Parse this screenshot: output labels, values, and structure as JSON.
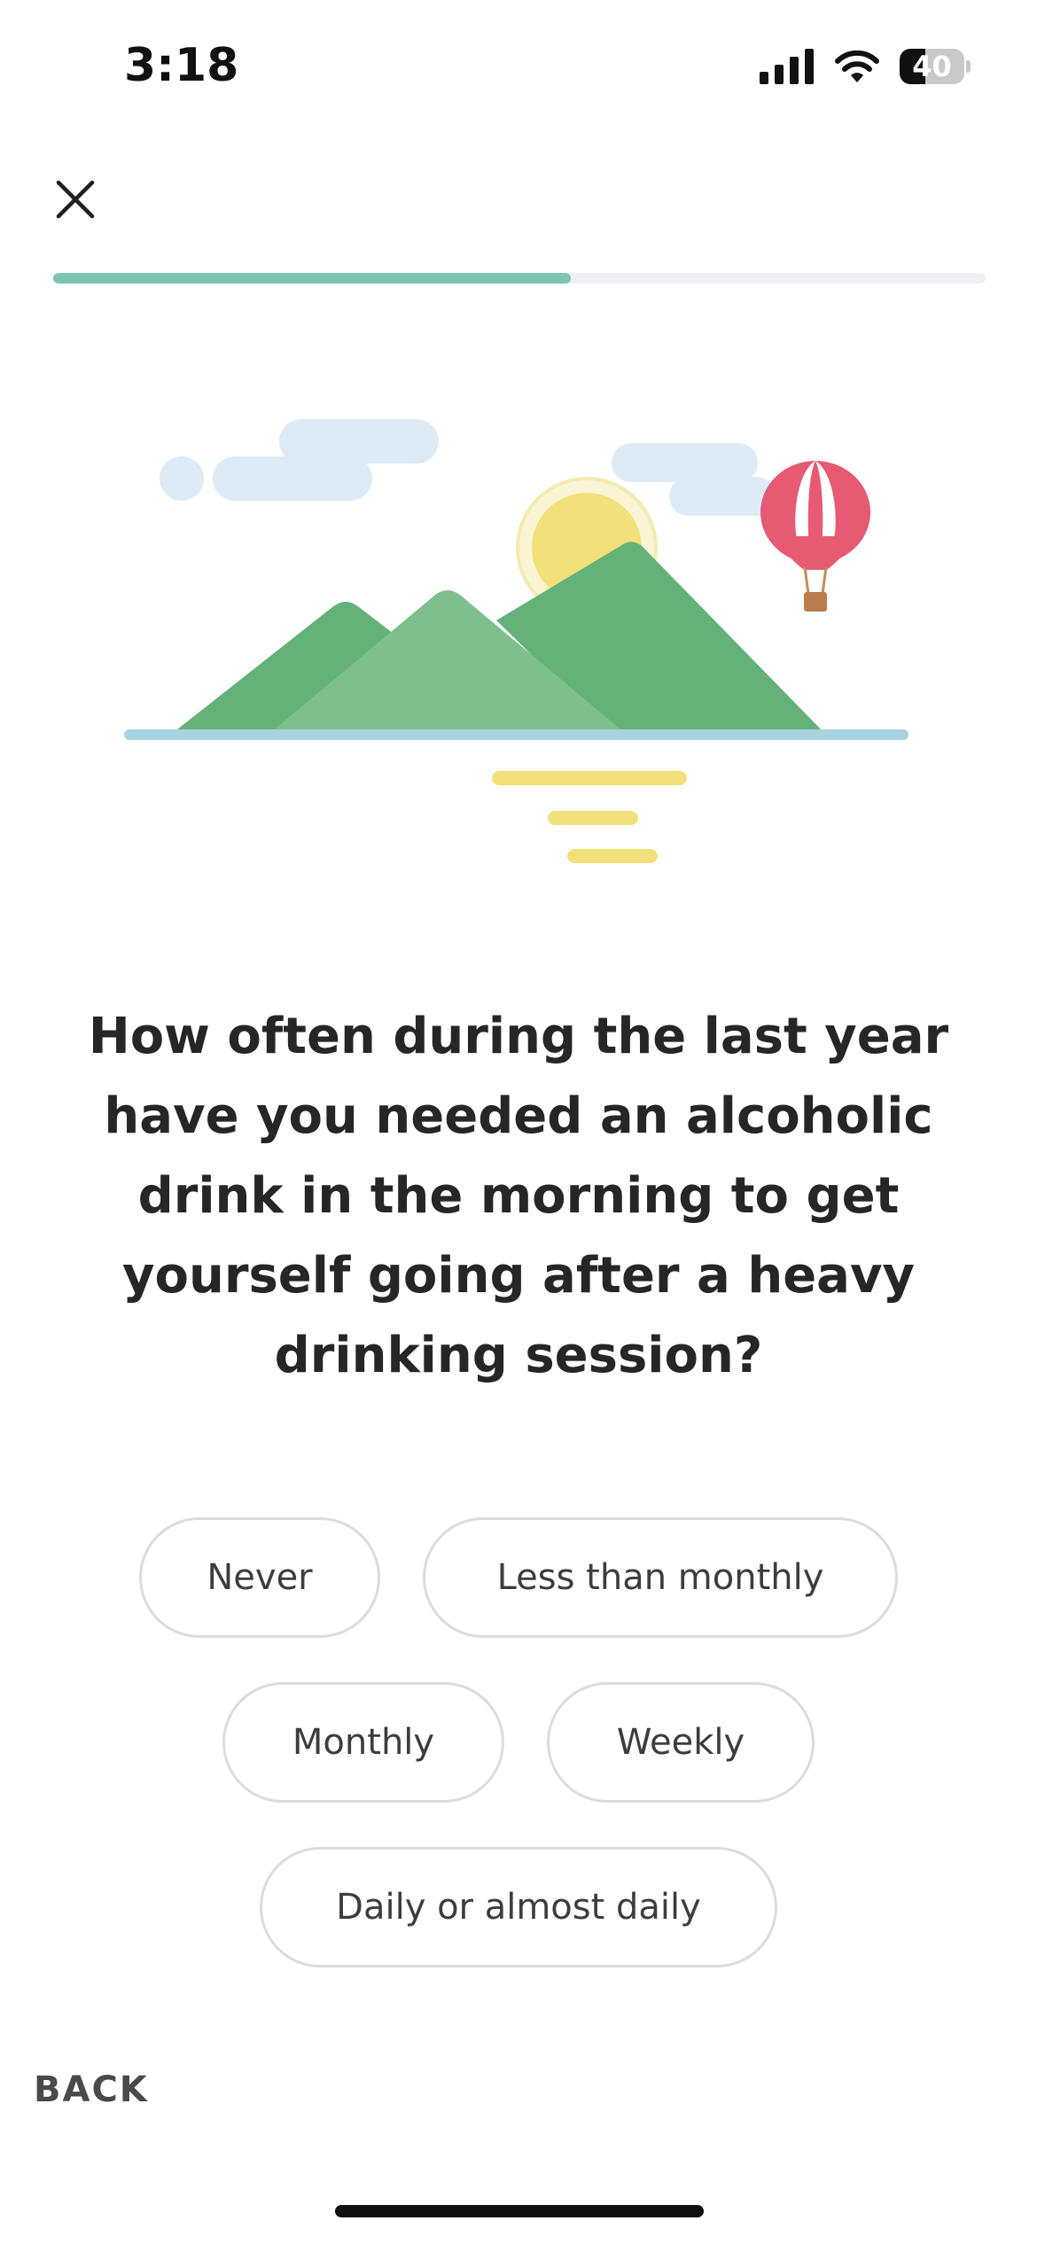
{
  "status_bar": {
    "time": "3:18",
    "battery_level": "40",
    "battery_percent": 40,
    "icons": [
      "signal-icon",
      "wifi-icon",
      "battery-icon"
    ]
  },
  "header": {
    "close_icon": "close-icon"
  },
  "progress": {
    "fraction": 0.555,
    "fill_color": "#7cc5b3",
    "track_color": "#eef0f3"
  },
  "question": {
    "text": "How often during the last year have you needed an alcoholic drink in the morning to get yourself going after a heavy drinking session?"
  },
  "options": {
    "rows": [
      [
        "Never",
        "Less than monthly"
      ],
      [
        "Monthly",
        "Weekly"
      ],
      [
        "Daily or almost daily"
      ]
    ]
  },
  "footer": {
    "back_label": "BACK"
  },
  "colors": {
    "mountain_dark": "#64b27a",
    "mountain_light": "#7fbf8e",
    "sun": "#f2e07a",
    "cloud": "#dcebf6",
    "water": "#a6d3de",
    "balloon_red": "#e65a73"
  }
}
